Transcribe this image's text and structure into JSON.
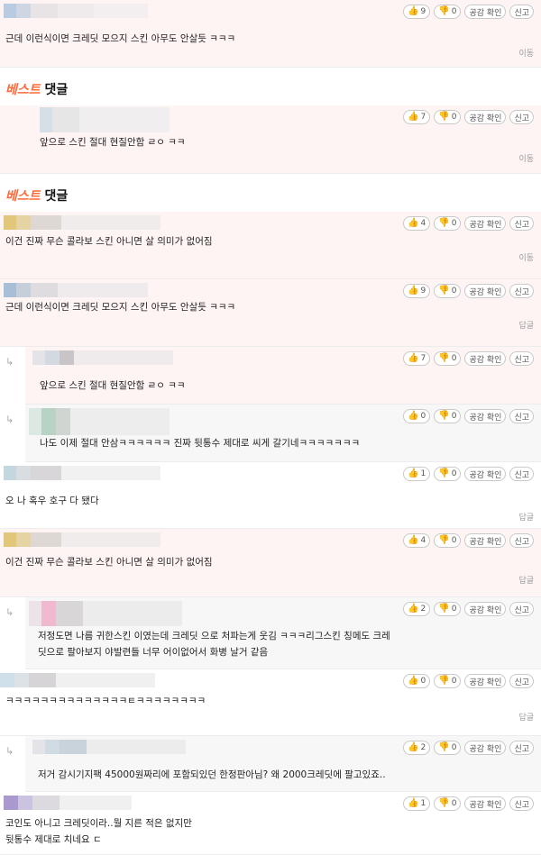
{
  "best_label": {
    "part1": "베스트",
    "part2": "댓글"
  },
  "buttons": {
    "empathy": "공감 확인",
    "report": "신고"
  },
  "comments": [
    {
      "likes": "9",
      "dislikes": "0",
      "text": "근데 이런식이면 크레딧 모으지 스킨 아무도 안살듯 ㅋㅋㅋ",
      "meta": "이동"
    },
    {
      "likes": "7",
      "dislikes": "0",
      "text": "앞으로 스킨 절대 현질안함 ㄹㅇ ㅋㅋ",
      "meta": "이동"
    },
    {
      "likes": "4",
      "dislikes": "0",
      "text": "이건 진짜 무슨 콜라보 스킨 아니면 살 의미가 없어짐",
      "meta": "이동"
    },
    {
      "likes": "9",
      "dislikes": "0",
      "text": "근데 이런식이면 크레딧 모으지 스킨 아무도 안살듯 ㅋㅋㅋ",
      "meta": "답글"
    },
    {
      "likes": "7",
      "dislikes": "0",
      "text": "앞으로 스킨 절대 현질안함 ㄹㅇ ㅋㅋ",
      "meta": ""
    },
    {
      "likes": "0",
      "dislikes": "0",
      "text": "나도 이제 절대 안삼ㅋㅋㅋㅋㅋㅋ 진짜 뒷통수 제대로 씨게 갈기네ㅋㅋㅋㅋㅋㅋㅋ",
      "meta": ""
    },
    {
      "likes": "1",
      "dislikes": "0",
      "text": "오 나 혹우 호구 다 됐다",
      "meta": "답글"
    },
    {
      "likes": "4",
      "dislikes": "0",
      "text": "이건 진짜 무슨 콜라보 스킨 아니면 살 의미가 없어짐",
      "meta": "답글"
    },
    {
      "likes": "2",
      "dislikes": "0",
      "text": "저정도면 나름 귀한스킨 이였는데 크레딧 으로 처파는게 웃김 ㅋㅋㅋ리그스킨 칭메도 크레\n딧으로 팔아보지 야발련들 너무 어이없어서 화병 날거 같음",
      "meta": ""
    },
    {
      "likes": "0",
      "dislikes": "0",
      "text": "ㅋㅋㅋㅋㅋㅋㅋㅋㅋㅋㅋㅋㅋㅋㅌㅋㅋㅋㅋㅋㅋㅋㅋ",
      "meta": "답글"
    },
    {
      "likes": "2",
      "dislikes": "0",
      "text": "저거 감시기지팩 45000원짜리에 포함되있던 한정판아님? 왜 2000크레딧에 팔고있죠..",
      "meta": ""
    },
    {
      "likes": "1",
      "dislikes": "0",
      "text": "코인도 아니고 크레딧이라..뭘 지른 적은 없지만\n뒷통수 제대로 치네요 ㄷ",
      "meta": ""
    }
  ]
}
